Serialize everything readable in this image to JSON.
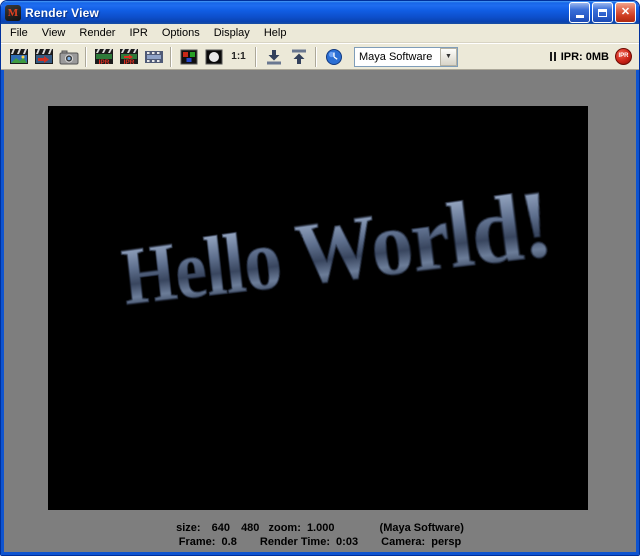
{
  "window": {
    "title": "Render View",
    "app_icon_letter": "M"
  },
  "menu": {
    "items": [
      "File",
      "View",
      "Render",
      "IPR",
      "Options",
      "Display",
      "Help"
    ]
  },
  "toolbar": {
    "icon_names": [
      "render-current-frame",
      "redo-previous-render",
      "snapshot",
      "ipr-render-current-frame",
      "redo-previous-ipr-render",
      "refresh-ipr-image",
      "display-rgb-channels",
      "display-alpha-channel",
      "real-size",
      "keep-image",
      "remove-image",
      "open-render-globals"
    ],
    "real_size_label": "1:1",
    "renderer_dropdown": {
      "value": "Maya Software"
    },
    "ipr_status": "IPR: 0MB",
    "ipr_button_label": "IPR"
  },
  "render_view": {
    "image_text": "Hello World!"
  },
  "status": {
    "size_label": "size:",
    "width": "640",
    "height": "480",
    "zoom_label": "zoom:",
    "zoom_value": "1.000",
    "renderer_note": "(Maya Software)",
    "frame_label": "Frame:",
    "frame_value": "0.8",
    "render_time_label": "Render Time:",
    "render_time_value": "0:03",
    "camera_label": "Camera:",
    "camera_value": "persp"
  },
  "colors": {
    "titlebar_blue": "#115ee4",
    "chrome_beige": "#ece9d8",
    "viewport_gray": "#7e7e7e",
    "ipr_red": "#cc2418",
    "text_steel_blue": "#8b9cb8"
  }
}
